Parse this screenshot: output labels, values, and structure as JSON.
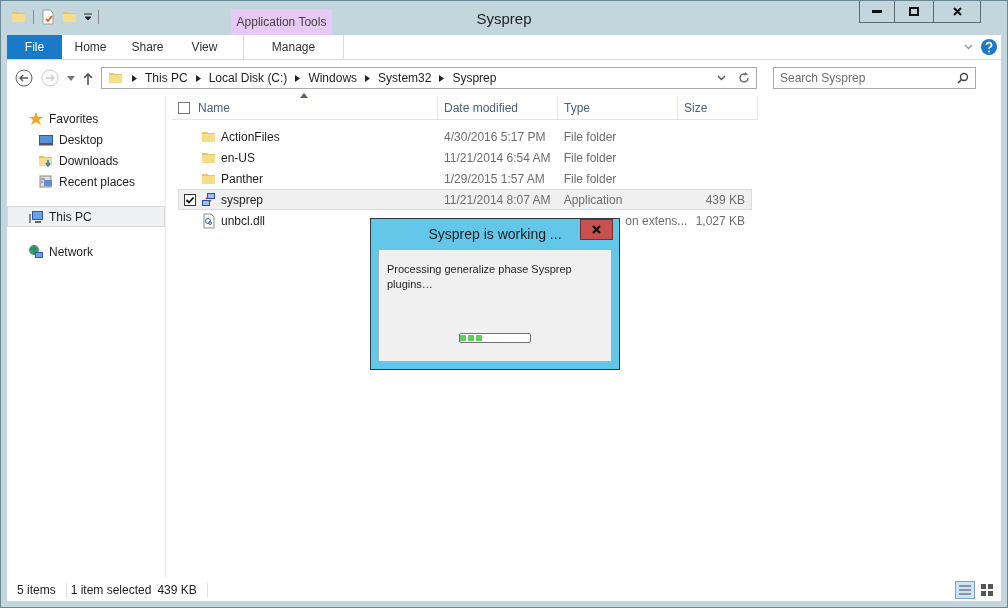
{
  "window": {
    "title": "Sysprep"
  },
  "ribbon": {
    "tabs": [
      {
        "label": "File",
        "kind": "file",
        "selected": false
      },
      {
        "label": "Home",
        "kind": "tab",
        "selected": false
      },
      {
        "label": "Share",
        "kind": "tab",
        "selected": false
      },
      {
        "label": "View",
        "kind": "tab",
        "selected": false
      }
    ],
    "contextual": {
      "label": "Application Tools",
      "tabs": [
        {
          "label": "Manage",
          "selected": false
        }
      ]
    }
  },
  "address": {
    "crumbs": [
      "This PC",
      "Local Disk (C:)",
      "Windows",
      "System32",
      "Sysprep"
    ]
  },
  "search": {
    "placeholder": "Search Sysprep"
  },
  "sidebar": {
    "items": [
      {
        "label": "Favorites",
        "kind": "favorites",
        "selected": false,
        "children": [
          {
            "label": "Desktop",
            "kind": "desktop",
            "selected": false
          },
          {
            "label": "Downloads",
            "kind": "downloads",
            "selected": false
          },
          {
            "label": "Recent places",
            "kind": "recent",
            "selected": false
          }
        ]
      },
      {
        "label": "This PC",
        "kind": "pc",
        "selected": true
      },
      {
        "label": "Network",
        "kind": "network",
        "selected": false
      }
    ]
  },
  "table": {
    "select_all_checked": false,
    "columns": [
      "Name",
      "Date modified",
      "Type",
      "Size"
    ],
    "rows": [
      {
        "kind": "folder",
        "name": "ActionFiles",
        "date": "4/30/2016 5:17 PM",
        "type": "File folder",
        "selected": false,
        "checked": false
      },
      {
        "kind": "folder",
        "name": "en-US",
        "date": "11/21/2014 6:54 AM",
        "type": "File folder",
        "selected": false,
        "checked": false
      },
      {
        "kind": "folder",
        "name": "Panther",
        "date": "1/29/2015 1:57 AM",
        "type": "File folder",
        "selected": false,
        "checked": false
      },
      {
        "kind": "app",
        "name": "sysprep",
        "date": "11/21/2014 8:07 AM",
        "type": "Application",
        "size": "439 KB",
        "selected": true,
        "checked": true
      },
      {
        "kind": "dll",
        "name": "unbcl.dll",
        "type": "on extens...",
        "size": "1,027 KB",
        "selected": false,
        "checked": false
      }
    ]
  },
  "status_bar": {
    "items": "5 items",
    "selection": "1 item selected",
    "size": "439 KB"
  },
  "dialog": {
    "title": "Sysprep is working ...",
    "message": "Processing generalize phase Sysprep plugins…",
    "progress": {
      "level": 0.33
    }
  }
}
